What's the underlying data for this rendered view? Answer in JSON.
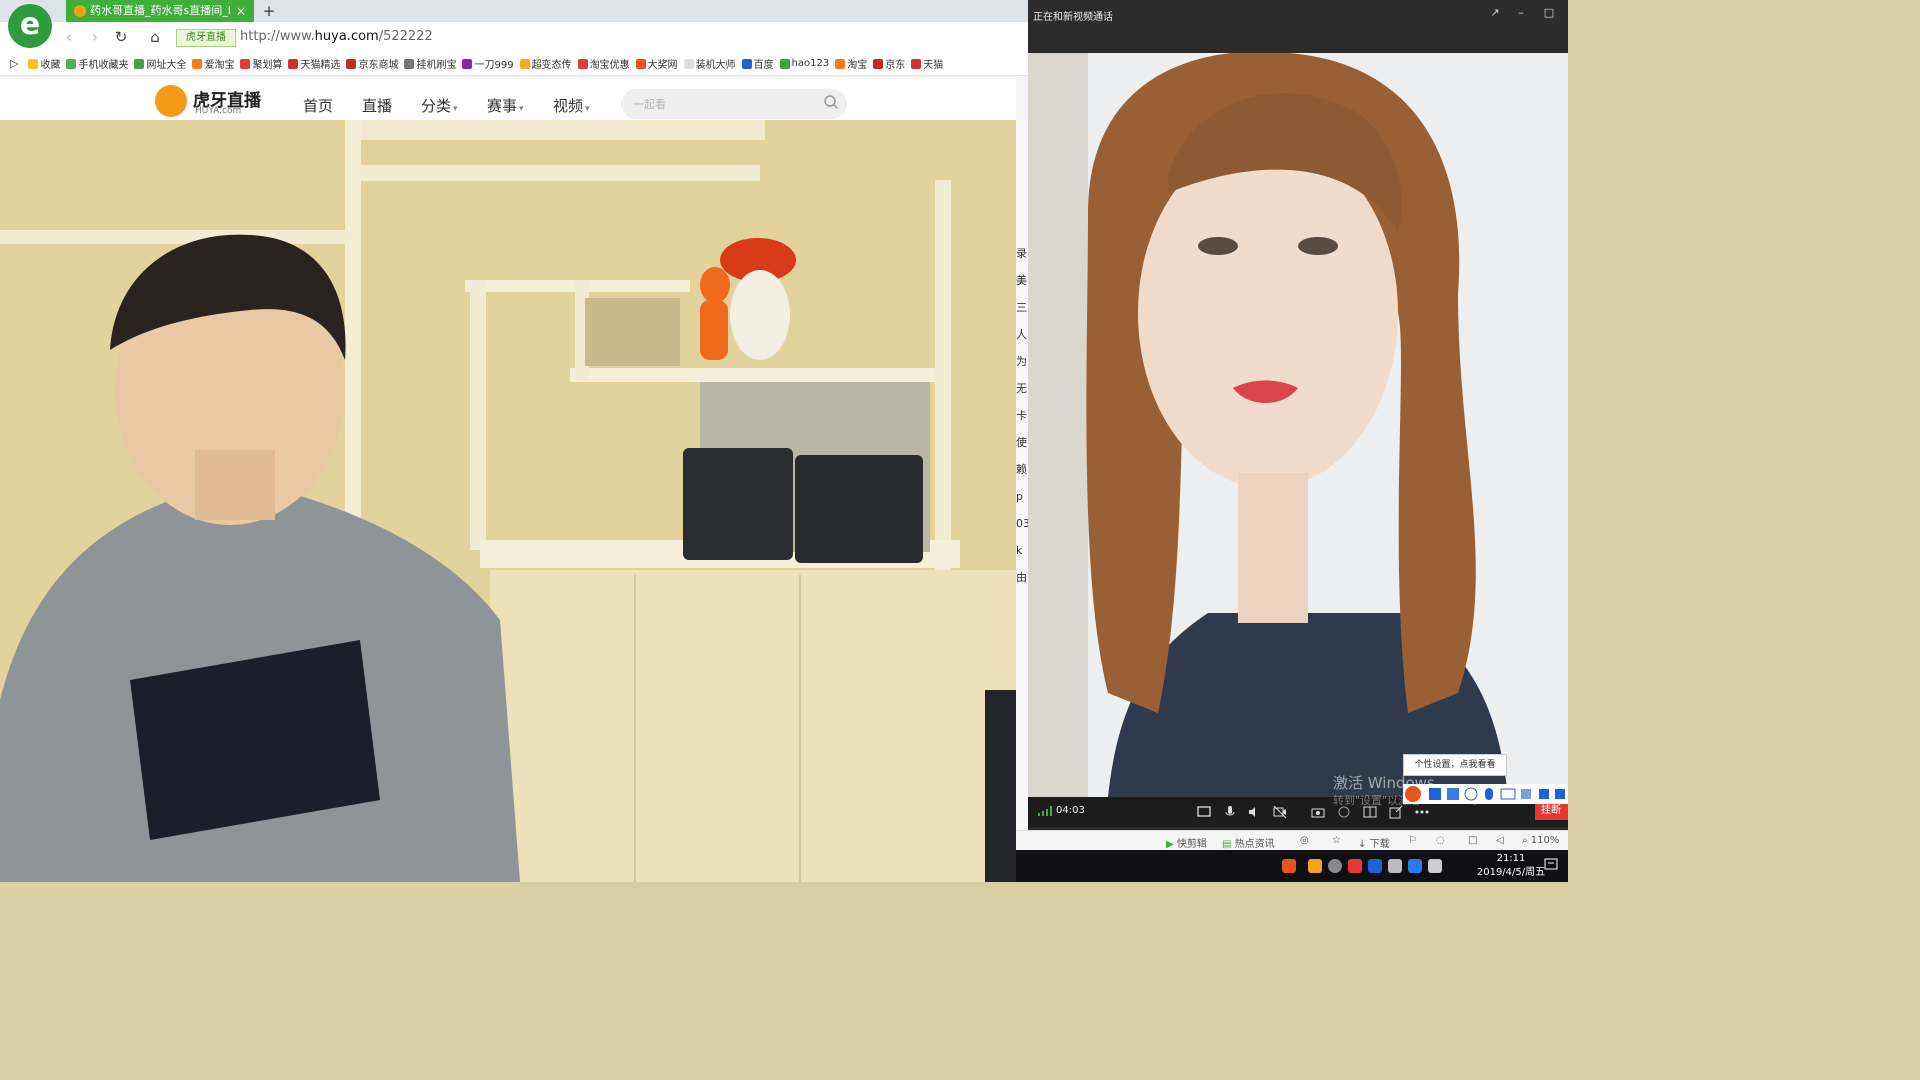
{
  "browser": {
    "tab_title": "药水哥直播_药水哥s直播间_lol",
    "tab_close": "×",
    "new_tab": "+",
    "site_badge": "虎牙直播",
    "url_prefix": "http://www.",
    "url_domain": "huya.com",
    "url_path": "/522222",
    "bookmarks": [
      "收藏",
      "手机收藏夹",
      "网址大全",
      "爱淘宝",
      "聚划算",
      "天猫精选",
      "京东商城",
      "挂机刷宝",
      "一刀999",
      "超变态传",
      "淘宝优惠",
      "大奖网",
      "装机大师",
      "百度",
      "hao123",
      "淘宝",
      "京东",
      "天猫"
    ]
  },
  "huya": {
    "logo_text": "虎牙直播",
    "logo_sub": "HUYA.com",
    "nav": [
      "首页",
      "直播",
      "分类",
      "赛事",
      "视频"
    ],
    "search_placeholder": "一起看"
  },
  "sidebar_chars": [
    "录",
    "美",
    "三",
    "人",
    "为",
    "无",
    "卡",
    "使",
    "赖",
    "p",
    "03",
    "k",
    "由"
  ],
  "call": {
    "title": "正在和新视频通话",
    "timer": "04:03",
    "hangup": "挂断",
    "tooltip": "个性设置，点我看看",
    "watermark_line1": "激活 Windows",
    "watermark_line2": "转到\"设置\"以激活 Windows。"
  },
  "statusbar": {
    "items": [
      "快剪辑",
      "热点资讯",
      "下载",
      "110%"
    ]
  },
  "taskbar": {
    "time": "21:11",
    "date": "2019/4/5/周五"
  },
  "colors": {
    "tab_green": "#3fae3a",
    "huya_orange": "#f59a1b",
    "hangup_red": "#e53935"
  }
}
